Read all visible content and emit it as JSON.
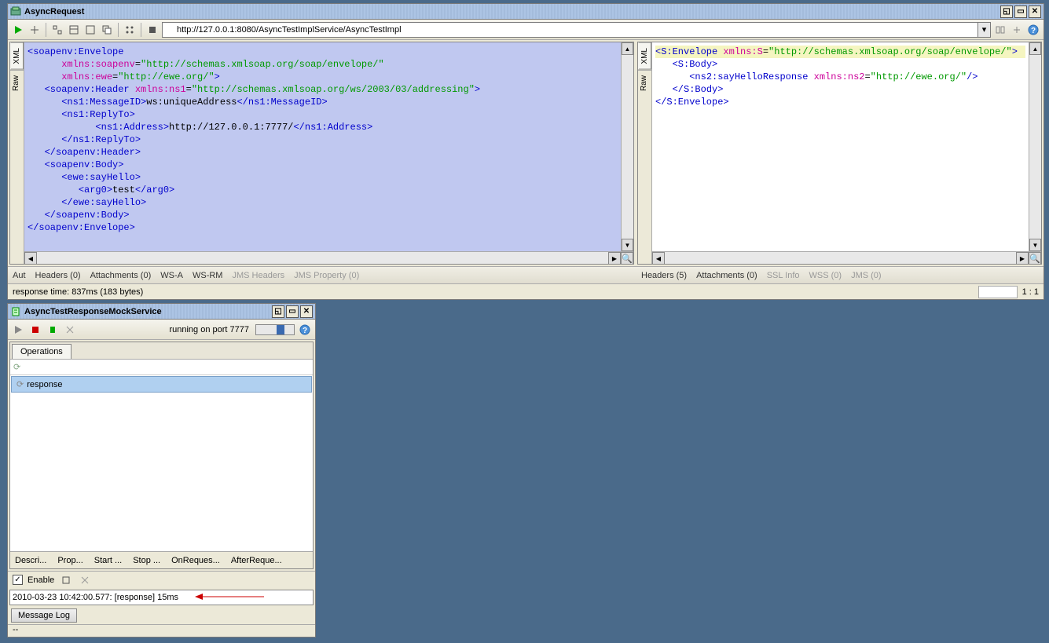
{
  "request_window": {
    "title": "AsyncRequest",
    "url": "http://127.0.0.1:8080/AsyncTestImplService/AsyncTestImpl",
    "side_tabs": [
      "XML",
      "Raw"
    ],
    "request_xml_lines": [
      {
        "indent": 0,
        "parts": [
          {
            "t": "tag",
            "v": "<soapenv:Envelope"
          }
        ]
      },
      {
        "indent": 2,
        "parts": [
          {
            "t": "attr",
            "v": "xmlns:soapenv"
          },
          {
            "t": "plain",
            "v": "="
          },
          {
            "t": "val",
            "v": "\"http://schemas.xmlsoap.org/soap/envelope/\""
          }
        ]
      },
      {
        "indent": 2,
        "parts": [
          {
            "t": "attr",
            "v": "xmlns:ewe"
          },
          {
            "t": "plain",
            "v": "="
          },
          {
            "t": "val",
            "v": "\"http://ewe.org/\""
          },
          {
            "t": "tag",
            "v": ">"
          }
        ]
      },
      {
        "indent": 1,
        "parts": [
          {
            "t": "tag",
            "v": "<soapenv:Header "
          },
          {
            "t": "attr",
            "v": "xmlns:ns1"
          },
          {
            "t": "plain",
            "v": "="
          },
          {
            "t": "val",
            "v": "\"http://schemas.xmlsoap.org/ws/2003/03/addressing\""
          },
          {
            "t": "tag",
            "v": ">"
          }
        ]
      },
      {
        "indent": 2,
        "parts": [
          {
            "t": "tag",
            "v": "<ns1:MessageID>"
          },
          {
            "t": "text",
            "v": "ws:uniqueAddress"
          },
          {
            "t": "tag",
            "v": "</ns1:MessageID>"
          }
        ]
      },
      {
        "indent": 2,
        "parts": [
          {
            "t": "tag",
            "v": "<ns1:ReplyTo>"
          }
        ]
      },
      {
        "indent": 4,
        "parts": [
          {
            "t": "tag",
            "v": "<ns1:Address>"
          },
          {
            "t": "text",
            "v": "http://127.0.0.1:7777/"
          },
          {
            "t": "tag",
            "v": "</ns1:Address>"
          }
        ]
      },
      {
        "indent": 2,
        "parts": [
          {
            "t": "tag",
            "v": "</ns1:ReplyTo>"
          }
        ]
      },
      {
        "indent": 1,
        "parts": [
          {
            "t": "tag",
            "v": "</soapenv:Header>"
          }
        ]
      },
      {
        "indent": 1,
        "parts": [
          {
            "t": "tag",
            "v": "<soapenv:Body>"
          }
        ]
      },
      {
        "indent": 2,
        "parts": [
          {
            "t": "tag",
            "v": "<ewe:sayHello>"
          }
        ]
      },
      {
        "indent": 3,
        "parts": [
          {
            "t": "tag",
            "v": "<arg0>"
          },
          {
            "t": "text",
            "v": "test"
          },
          {
            "t": "tag",
            "v": "</arg0>"
          }
        ]
      },
      {
        "indent": 2,
        "parts": [
          {
            "t": "tag",
            "v": "</ewe:sayHello>"
          }
        ]
      },
      {
        "indent": 1,
        "parts": [
          {
            "t": "tag",
            "v": "</soapenv:Body>"
          }
        ]
      },
      {
        "indent": 0,
        "parts": [
          {
            "t": "tag",
            "v": "</soapenv:Envelope>"
          }
        ]
      }
    ],
    "response_xml_lines": [
      {
        "indent": 0,
        "hl": true,
        "parts": [
          {
            "t": "tag",
            "v": "<S:Envelope "
          },
          {
            "t": "attr",
            "v": "xmlns:S"
          },
          {
            "t": "plain",
            "v": "="
          },
          {
            "t": "val",
            "v": "\"http://schemas.xmlsoap.org/soap/envelope/\""
          },
          {
            "t": "tag",
            "v": ">"
          }
        ]
      },
      {
        "indent": 1,
        "parts": [
          {
            "t": "tag",
            "v": "<S:Body>"
          }
        ]
      },
      {
        "indent": 2,
        "parts": [
          {
            "t": "tag",
            "v": "<ns2:sayHelloResponse "
          },
          {
            "t": "attr",
            "v": "xmlns:ns2"
          },
          {
            "t": "plain",
            "v": "="
          },
          {
            "t": "val",
            "v": "\"http://ewe.org/\""
          },
          {
            "t": "tag",
            "v": "/>"
          }
        ]
      },
      {
        "indent": 1,
        "parts": [
          {
            "t": "tag",
            "v": "</S:Body>"
          }
        ]
      },
      {
        "indent": 0,
        "parts": [
          {
            "t": "tag",
            "v": "</S:Envelope>"
          }
        ]
      }
    ],
    "request_tabs": [
      "Aut",
      "Headers (0)",
      "Attachments (0)",
      "WS-A",
      "WS-RM",
      "JMS Headers",
      "JMS Property (0)"
    ],
    "response_tabs": [
      "Headers (5)",
      "Attachments (0)",
      "SSL Info",
      "WSS (0)",
      "JMS (0)"
    ],
    "status_left": "response time: 837ms (183 bytes)",
    "status_right": "1 : 1"
  },
  "mock_window": {
    "title": "AsyncTestResponseMockService",
    "running_text": "running on port 7777",
    "operations_tab": "Operations",
    "op_item": "response",
    "script_tabs": [
      "Descri...",
      "Prop...",
      "Start ...",
      "Stop ...",
      "OnReques...",
      "AfterReque..."
    ],
    "enable_label": "Enable",
    "log_line": "2010-03-23 10:42:00.577: [response] 15ms",
    "message_log": "Message Log",
    "tiny_status": "--"
  }
}
